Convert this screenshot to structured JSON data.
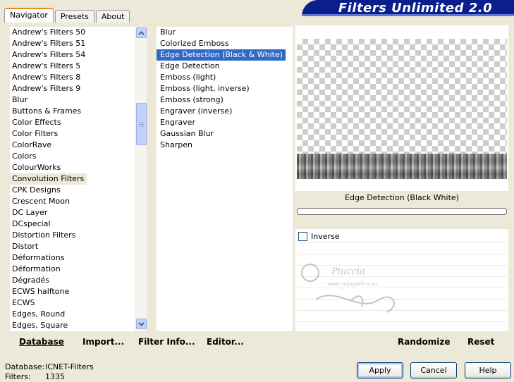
{
  "tabs": [
    "Navigator",
    "Presets",
    "About"
  ],
  "banner_title": "Filters Unlimited 2.0",
  "categories": [
    "Andrew's Filters 50",
    "Andrew's Filters 51",
    "Andrew's Filters 54",
    "Andrew's Filters 5",
    "Andrew's Filters 8",
    "Andrew's Filters 9",
    "Blur",
    "Buttons & Frames",
    "Color Effects",
    "Color Filters",
    "ColorRave",
    "Colors",
    "ColourWorks",
    "Convolution Filters",
    "CPK Designs",
    "Crescent Moon",
    "DC Layer",
    "DCspecial",
    "Distortion Filters",
    "Distort",
    "Déformations",
    "Déformation",
    "Dégradés",
    "ECWS halftone",
    "ECWS",
    "Edges, Round",
    "Edges, Square"
  ],
  "selected_category": "Convolution Filters",
  "filters": [
    "Blur",
    "Colorized Emboss",
    "Edge Detection (Black & White)",
    "Edge Detection",
    "Emboss (light)",
    "Emboss (light, inverse)",
    "Emboss (strong)",
    "Engraver (inverse)",
    "Engraver",
    "Gaussian Blur",
    "Sharpen"
  ],
  "selected_filter": "Edge Detection (Black & White)",
  "filter_name_label": "Edge Detection (Black  White)",
  "inverse_label": "Inverse",
  "inverse_checked": false,
  "watermark_text": "Piuccia",
  "watermark_url": "www.italiagrafica.eu",
  "toolbar": {
    "database": "Database",
    "import": "Import...",
    "filter_info": "Filter Info...",
    "editor": "Editor...",
    "randomize": "Randomize",
    "reset": "Reset"
  },
  "status": {
    "database_label": "Database:",
    "database_value": "ICNET-Filters",
    "filters_label": "Filters:",
    "filters_value": "1335"
  },
  "buttons": {
    "apply": "Apply",
    "cancel": "Cancel",
    "help": "Help"
  },
  "colors": {
    "selection": "#316ac5",
    "banner": "#0a1e8c",
    "dialog_bg": "#ece9d8"
  }
}
